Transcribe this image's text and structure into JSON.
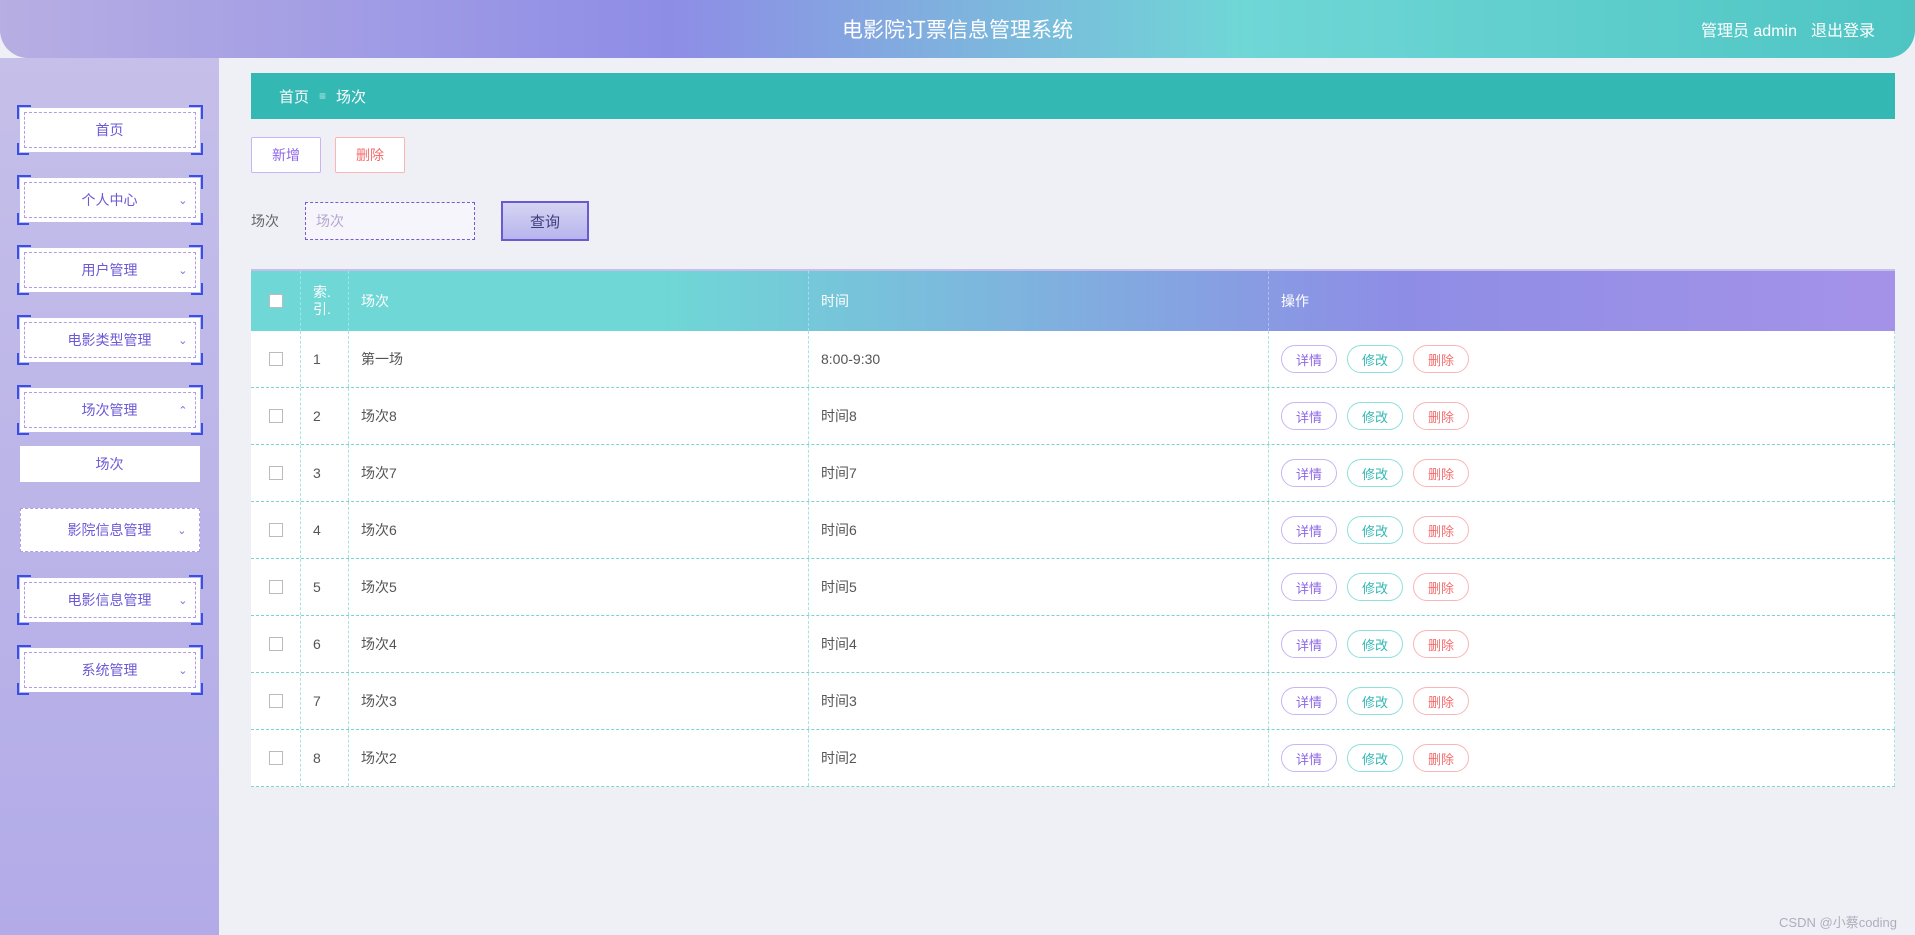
{
  "header": {
    "title": "电影院订票信息管理系统",
    "admin_label": "管理员 admin",
    "logout_label": "退出登录"
  },
  "sidebar": {
    "items": [
      {
        "label": "首页",
        "chevron": "",
        "corners": true
      },
      {
        "label": "个人中心",
        "chevron": "⌄",
        "corners": true
      },
      {
        "label": "用户管理",
        "chevron": "⌄",
        "corners": true
      },
      {
        "label": "电影类型管理",
        "chevron": "⌄",
        "corners": true
      },
      {
        "label": "场次管理",
        "chevron": "⌃",
        "corners": true
      },
      {
        "label": "场次",
        "chevron": "",
        "sub": true
      },
      {
        "label": "影院信息管理",
        "chevron": "⌄",
        "dashed_only": true
      },
      {
        "label": "电影信息管理",
        "chevron": "⌄",
        "corners": true
      },
      {
        "label": "系统管理",
        "chevron": "⌄",
        "corners": true
      }
    ]
  },
  "breadcrumb": {
    "home": "首页",
    "sep": "≡",
    "current": "场次"
  },
  "toolbar": {
    "add": "新增",
    "delete": "删除"
  },
  "filter": {
    "label": "场次",
    "placeholder": "场次",
    "query": "查询"
  },
  "table": {
    "headers": {
      "index": "索.引.",
      "col_a": "场次",
      "col_b": "时间",
      "op": "操作"
    },
    "ops": {
      "detail": "详情",
      "edit": "修改",
      "delete": "删除"
    },
    "rows": [
      {
        "idx": "1",
        "a": "第一场",
        "b": "8:00-9:30"
      },
      {
        "idx": "2",
        "a": "场次8",
        "b": "时间8"
      },
      {
        "idx": "3",
        "a": "场次7",
        "b": "时间7"
      },
      {
        "idx": "4",
        "a": "场次6",
        "b": "时间6"
      },
      {
        "idx": "5",
        "a": "场次5",
        "b": "时间5"
      },
      {
        "idx": "6",
        "a": "场次4",
        "b": "时间4"
      },
      {
        "idx": "7",
        "a": "场次3",
        "b": "时间3"
      },
      {
        "idx": "8",
        "a": "场次2",
        "b": "时间2"
      }
    ]
  },
  "watermark": "CSDN @小蔡coding"
}
